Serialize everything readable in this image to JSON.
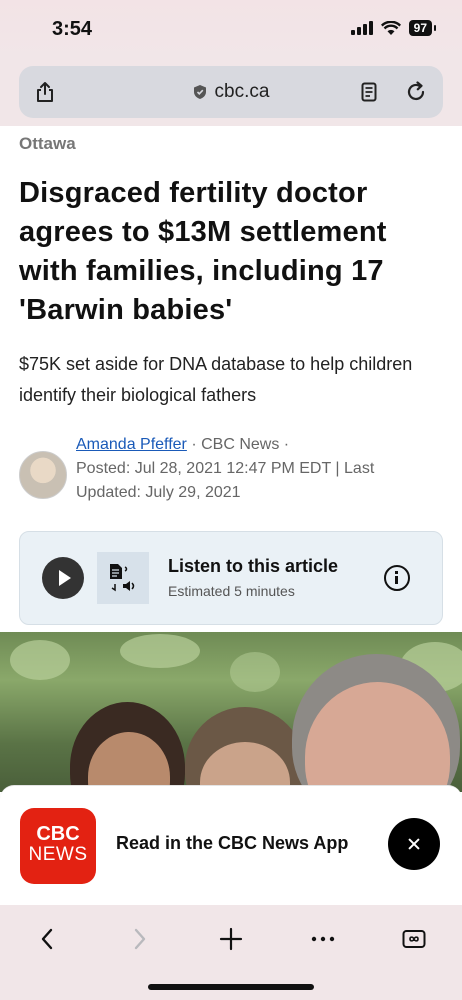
{
  "status": {
    "time": "3:54",
    "battery": "97"
  },
  "browser": {
    "url": "cbc.ca"
  },
  "article": {
    "section": "Ottawa",
    "headline": "Disgraced fertility doctor agrees to $13M settlement with families, including 17 'Barwin babies'",
    "deck": "$75K set aside for DNA database to help children identify their biological fathers",
    "author": "Amanda Pfeffer",
    "outlet": "· CBC News ·",
    "dates": "Posted: Jul 28, 2021 12:47 PM EDT | Last Updated: July 29, 2021"
  },
  "listen": {
    "title": "Listen to this article",
    "subtitle": "Estimated 5 minutes"
  },
  "app_banner": {
    "logo_line1": "CBC",
    "logo_line2": "NEWS",
    "text": "Read in the CBC News App"
  },
  "icons": {
    "share": "share-icon",
    "lock": "shield-icon",
    "reader": "reader-icon",
    "reload": "reload-icon",
    "back": "chevron-left-icon",
    "forward": "chevron-right-icon",
    "new_tab": "plus-icon",
    "more": "more-icon",
    "tabs": "tabs-icon"
  }
}
